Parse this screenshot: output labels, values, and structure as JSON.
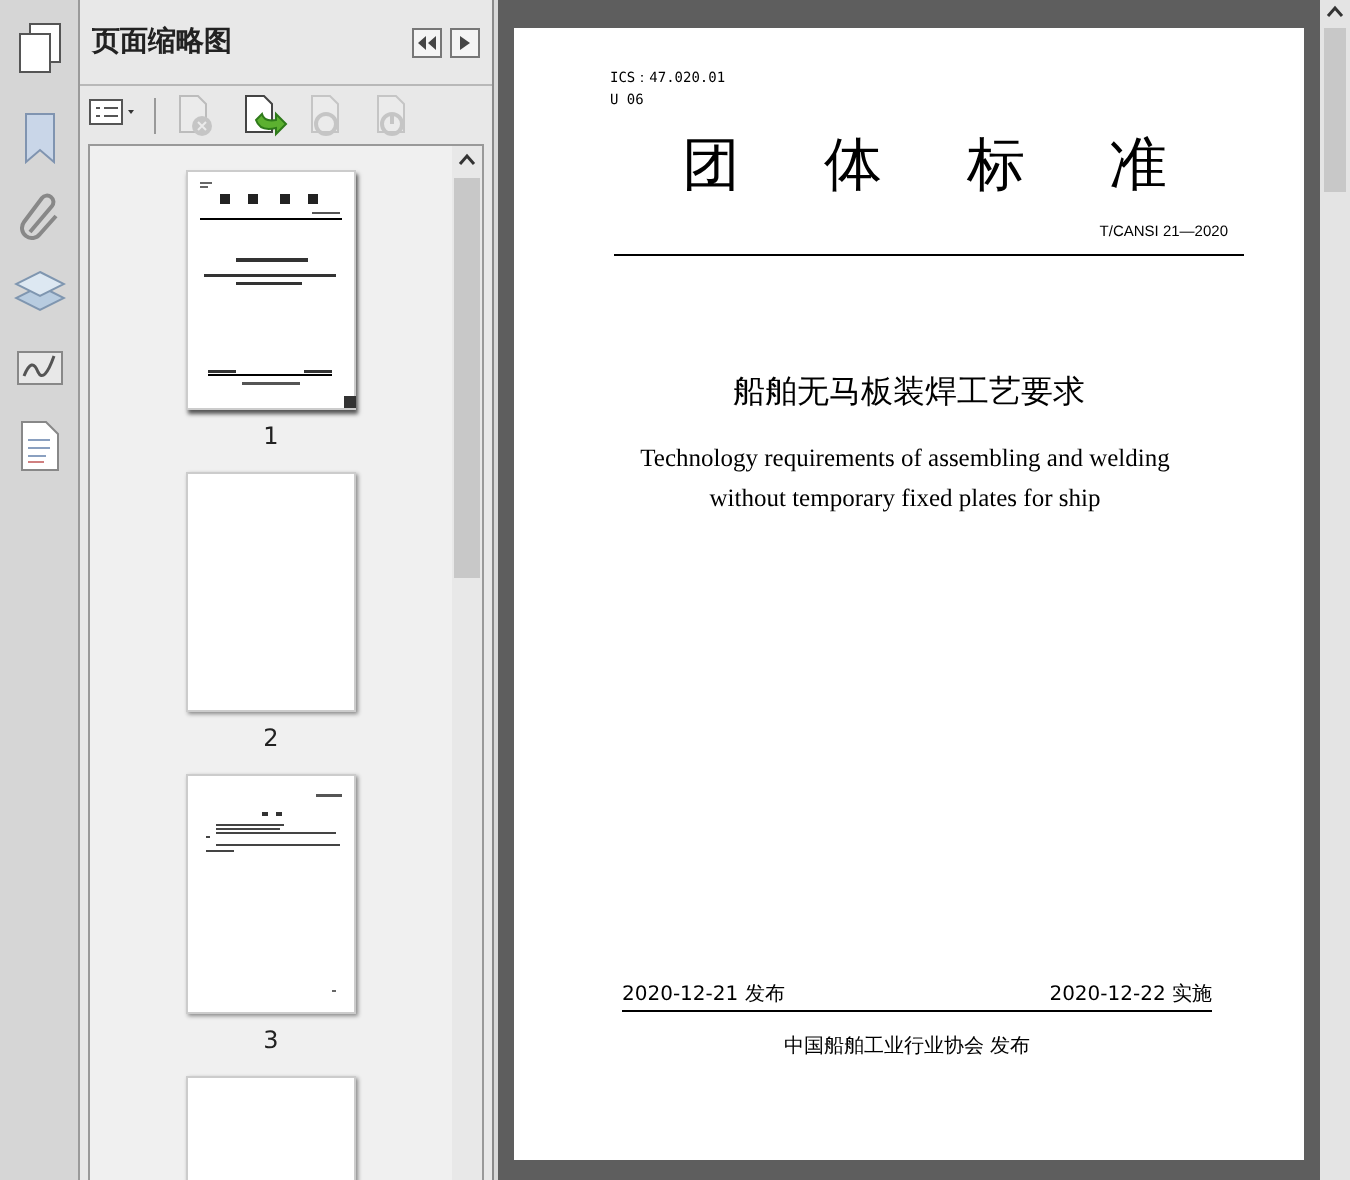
{
  "panel": {
    "title": "页面缩略图",
    "toolbar": [
      {
        "kind": "options",
        "disabled": false
      },
      {
        "kind": "delete",
        "disabled": true
      },
      {
        "kind": "insert",
        "disabled": false
      },
      {
        "kind": "undo",
        "disabled": true
      },
      {
        "kind": "redo",
        "disabled": true
      }
    ],
    "thumbnails": [
      {
        "kind": "cover",
        "label": "1",
        "selected": true
      },
      {
        "kind": "blank",
        "label": "2",
        "selected": false
      },
      {
        "kind": "text",
        "label": "3",
        "selected": false
      },
      {
        "kind": "blank",
        "selected": false
      }
    ]
  },
  "document": {
    "ics": "ICS：47.020.01",
    "ccs": "U 06",
    "heading": "团 体 标 准",
    "code": "T/CANSI 21—2020",
    "title_zh": "船舶无马板装焊工艺要求",
    "title_en": "Technology requirements of assembling and welding without temporary fixed plates for ship",
    "issue_date": "2020-12-21 发布",
    "effective_date": "2020-12-22 实施",
    "publisher": "中国船舶工业行业协会  发布"
  }
}
